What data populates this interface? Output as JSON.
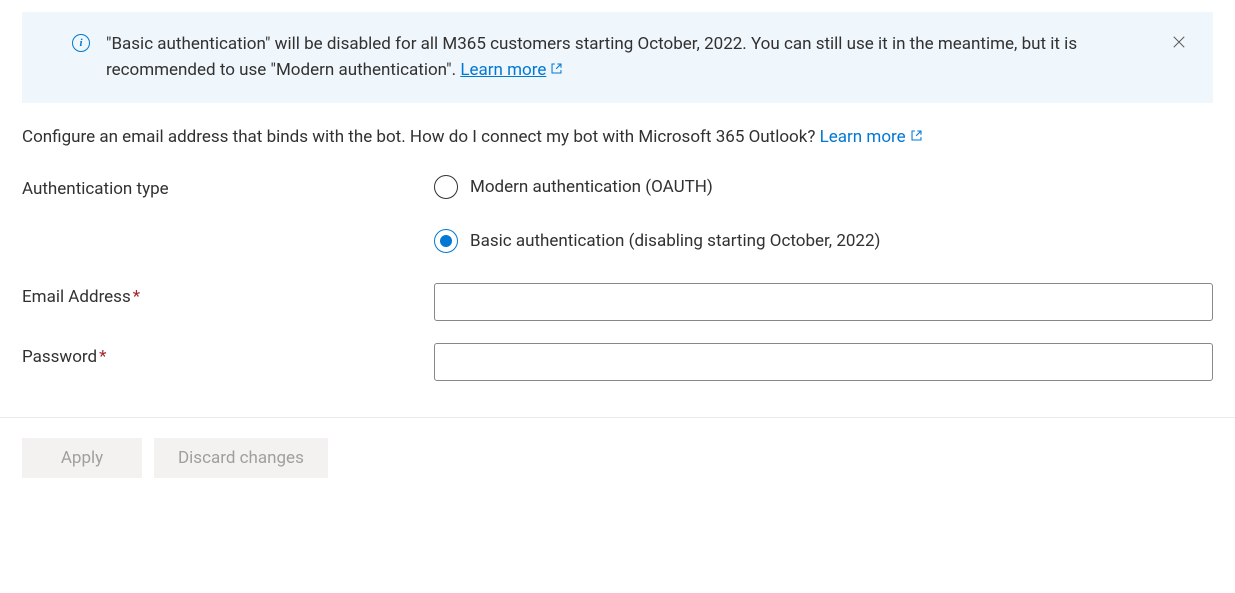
{
  "banner": {
    "text_part1": "\"Basic authentication\" will be disabled for all M365 customers starting October, 2022. You can still use it in the meantime, but it is recommended to use \"Modern authentication\". ",
    "learn_more": "Learn more"
  },
  "description": {
    "text": "Configure an email address that binds with the bot. How do I connect my bot with Microsoft 365 Outlook? ",
    "learn_more": "Learn more"
  },
  "form": {
    "auth_type_label": "Authentication type",
    "radio_modern": "Modern authentication (OAUTH)",
    "radio_basic": "Basic authentication (disabling starting October, 2022)",
    "selected": "basic",
    "email_label": "Email Address",
    "email_value": "",
    "password_label": "Password",
    "password_value": ""
  },
  "buttons": {
    "apply": "Apply",
    "discard": "Discard changes"
  }
}
